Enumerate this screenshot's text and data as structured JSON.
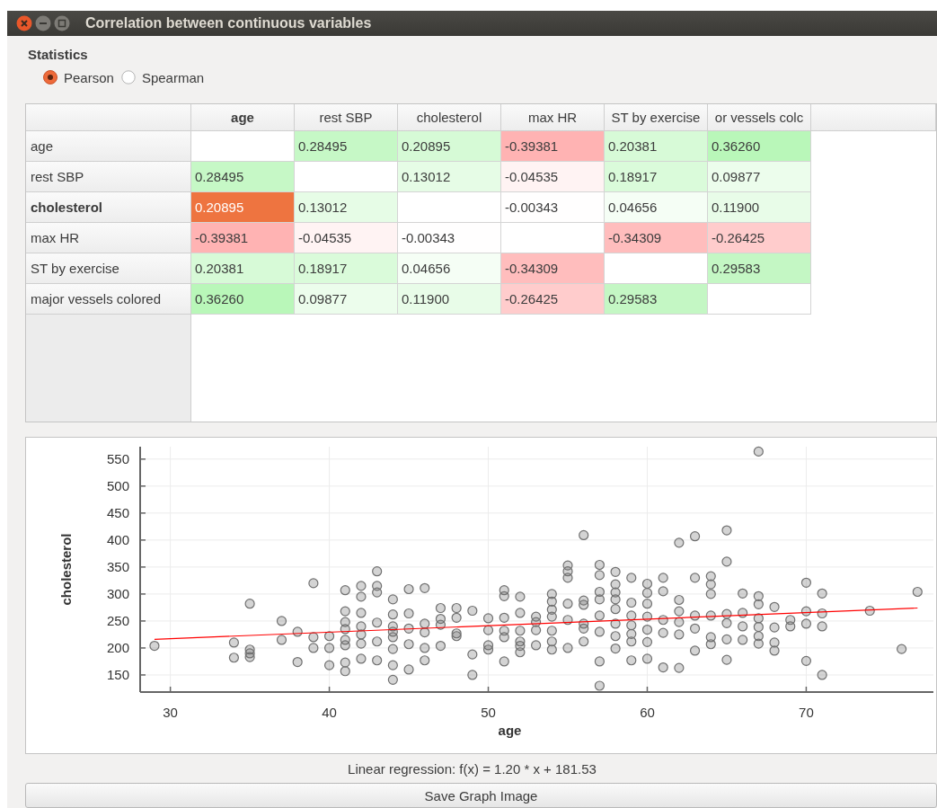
{
  "window": {
    "title": "Correlation between continuous variables"
  },
  "statistics": {
    "label": "Statistics",
    "options": [
      {
        "label": "Pearson",
        "selected": true
      },
      {
        "label": "Spearman",
        "selected": false
      }
    ]
  },
  "table": {
    "columns": [
      {
        "label": "age",
        "selected": true
      },
      {
        "label": "rest SBP",
        "selected": false
      },
      {
        "label": "cholesterol",
        "selected": false
      },
      {
        "label": "max HR",
        "selected": false
      },
      {
        "label": "ST by exercise",
        "selected": false
      },
      {
        "label": "or vessels colc",
        "selected": false
      }
    ],
    "rows": [
      {
        "label": "age",
        "selected": false,
        "cells": [
          {
            "selected": false
          },
          {
            "value": "0.28495",
            "color": "#c6f8c6",
            "selected": false
          },
          {
            "value": "0.20895",
            "color": "#d6fad6",
            "selected": false
          },
          {
            "value": "-0.39381",
            "color": "#ffb3b3",
            "selected": false
          },
          {
            "value": "0.20381",
            "color": "#d7fad7",
            "selected": false
          },
          {
            "value": "0.36260",
            "color": "#b9f7b9",
            "selected": false
          }
        ]
      },
      {
        "label": "rest SBP",
        "selected": false,
        "cells": [
          {
            "value": "0.28495",
            "color": "#c6f8c6",
            "selected": false
          },
          {
            "selected": false
          },
          {
            "value": "0.13012",
            "color": "#e6fce6",
            "selected": false
          },
          {
            "value": "-0.04535",
            "color": "#fff3f3",
            "selected": false
          },
          {
            "value": "0.18917",
            "color": "#dafbda",
            "selected": false
          },
          {
            "value": "0.09877",
            "color": "#ecfdec",
            "selected": false
          }
        ]
      },
      {
        "label": "cholesterol",
        "selected": true,
        "cells": [
          {
            "value": "0.20895",
            "selected": true
          },
          {
            "value": "0.13012",
            "color": "#e6fce6",
            "selected": false
          },
          {
            "selected": false
          },
          {
            "value": "-0.00343",
            "color": "#fffefe",
            "selected": false
          },
          {
            "value": "0.04656",
            "color": "#f5fef5",
            "selected": false
          },
          {
            "value": "0.11900",
            "color": "#e8fce8",
            "selected": false
          }
        ]
      },
      {
        "label": "max HR",
        "selected": false,
        "cells": [
          {
            "value": "-0.39381",
            "color": "#ffb3b3",
            "selected": false
          },
          {
            "value": "-0.04535",
            "color": "#fff3f3",
            "selected": false
          },
          {
            "value": "-0.00343",
            "color": "#fffefe",
            "selected": false
          },
          {
            "selected": false
          },
          {
            "value": "-0.34309",
            "color": "#ffbdbd",
            "selected": false
          },
          {
            "value": "-0.26425",
            "color": "#ffcccc",
            "selected": false
          }
        ]
      },
      {
        "label": "ST by exercise",
        "selected": false,
        "cells": [
          {
            "value": "0.20381",
            "color": "#d7fad7",
            "selected": false
          },
          {
            "value": "0.18917",
            "color": "#dafbda",
            "selected": false
          },
          {
            "value": "0.04656",
            "color": "#f5fef5",
            "selected": false
          },
          {
            "value": "-0.34309",
            "color": "#ffbdbd",
            "selected": false
          },
          {
            "selected": false
          },
          {
            "value": "0.29583",
            "color": "#c4f7c4",
            "selected": false
          }
        ]
      },
      {
        "label": "major vessels colored",
        "selected": false,
        "cells": [
          {
            "value": "0.36260",
            "color": "#b9f7b9",
            "selected": false
          },
          {
            "value": "0.09877",
            "color": "#ecfdec",
            "selected": false
          },
          {
            "value": "0.11900",
            "color": "#e8fce8",
            "selected": false
          },
          {
            "value": "-0.26425",
            "color": "#ffcccc",
            "selected": false
          },
          {
            "value": "0.29583",
            "color": "#c4f7c4",
            "selected": false
          },
          {
            "selected": false
          }
        ]
      }
    ]
  },
  "plot": {
    "chart_data": {
      "type": "scatter",
      "xlabel": "age",
      "ylabel": "cholesterol",
      "xlim": [
        28.1,
        78
      ],
      "ylim": [
        118.3,
        573
      ],
      "xticks": [
        30,
        40,
        50,
        60,
        70
      ],
      "yticks": [
        150,
        200,
        250,
        300,
        350,
        400,
        450,
        500,
        550
      ],
      "series": [
        {
          "color": "#707070",
          "x": [
            29,
            34,
            34,
            35,
            35,
            35,
            35,
            37,
            37,
            38,
            38,
            39,
            39,
            39,
            40,
            40,
            40,
            41,
            41,
            41,
            41,
            41,
            41,
            41,
            41,
            42,
            42,
            42,
            42,
            42,
            42,
            42,
            43,
            43,
            43,
            43,
            43,
            43,
            44,
            44,
            44,
            44,
            44,
            44,
            44,
            44,
            45,
            45,
            45,
            45,
            45,
            46,
            46,
            46,
            46,
            46,
            47,
            47,
            47,
            47,
            48,
            48,
            48,
            48,
            49,
            49,
            49,
            50,
            50,
            50,
            50,
            51,
            51,
            51,
            51,
            51,
            51,
            52,
            52,
            52,
            52,
            52,
            52,
            53,
            53,
            53,
            53,
            54,
            54,
            54,
            54,
            54,
            54,
            54,
            55,
            55,
            55,
            55,
            55,
            55,
            56,
            56,
            56,
            56,
            56,
            56,
            57,
            57,
            57,
            57,
            57,
            57,
            57,
            57,
            58,
            58,
            58,
            58,
            58,
            58,
            58,
            58,
            59,
            59,
            59,
            59,
            59,
            59,
            59,
            60,
            60,
            60,
            60,
            60,
            60,
            60,
            61,
            61,
            61,
            61,
            61,
            62,
            62,
            62,
            62,
            62,
            62,
            63,
            63,
            63,
            63,
            63,
            64,
            64,
            64,
            64,
            64,
            64,
            65,
            65,
            65,
            65,
            65,
            65,
            66,
            66,
            66,
            66,
            67,
            67,
            67,
            67,
            67,
            67,
            67,
            68,
            68,
            68,
            68,
            69,
            69,
            70,
            70,
            70,
            70,
            71,
            71,
            71,
            71,
            74,
            76,
            77
          ],
          "values": [
            204,
            210,
            182,
            282,
            197,
            190,
            183,
            250,
            215,
            230,
            174,
            320,
            220,
            200,
            222,
            200,
            168,
            307,
            268,
            248,
            235,
            215,
            205,
            173,
            157,
            315,
            295,
            265,
            240,
            225,
            208,
            180,
            342,
            315,
            303,
            247,
            212,
            177,
            290,
            262,
            240,
            230,
            220,
            198,
            168,
            141,
            309,
            264,
            236,
            207,
            160,
            311,
            245,
            229,
            200,
            177,
            274,
            254,
            243,
            204,
            274,
            256,
            227,
            222,
            269,
            188,
            150,
            255,
            233,
            205,
            197,
            307,
            296,
            256,
            232,
            220,
            175,
            295,
            265,
            232,
            212,
            204,
            192,
            258,
            248,
            233,
            205,
            300,
            286,
            271,
            258,
            232,
            212,
            197,
            353,
            342,
            330,
            282,
            252,
            200,
            409,
            288,
            280,
            245,
            236,
            212,
            354,
            335,
            304,
            290,
            260,
            230,
            175,
            130,
            341,
            318,
            303,
            290,
            272,
            245,
            222,
            199,
            330,
            284,
            260,
            242,
            226,
            212,
            177,
            319,
            302,
            282,
            258,
            234,
            211,
            180,
            330,
            305,
            252,
            228,
            164,
            395,
            289,
            268,
            248,
            225,
            163,
            407,
            330,
            260,
            236,
            195,
            333,
            318,
            300,
            260,
            220,
            207,
            418,
            360,
            263,
            246,
            216,
            178,
            301,
            265,
            240,
            215,
            564,
            296,
            281,
            255,
            239,
            222,
            208,
            276,
            238,
            210,
            195,
            252,
            240,
            321,
            268,
            245,
            176,
            301,
            264,
            240,
            150,
            269,
            198,
            304
          ]
        },
        {
          "type": "line",
          "color": "#ff0000",
          "x": [
            29,
            77
          ],
          "values": [
            216,
            274
          ]
        }
      ],
      "grid": true
    }
  },
  "regression_text": "Linear regression: f(x) = 1.20 * x + 181.53",
  "buttons": [
    {
      "label": "Save Graph Image"
    }
  ]
}
